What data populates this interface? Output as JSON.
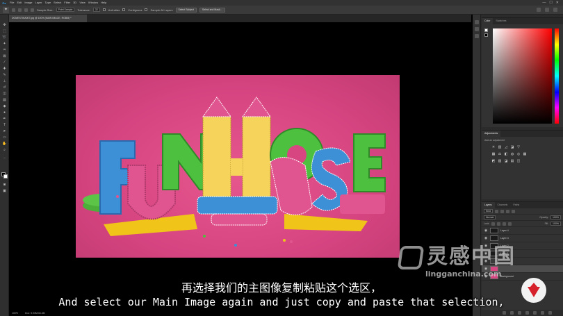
{
  "app": {
    "logo_text": "Ps",
    "menu": [
      "File",
      "Edit",
      "Image",
      "Layer",
      "Type",
      "Select",
      "Filter",
      "3D",
      "View",
      "Window",
      "Help"
    ],
    "window_controls": [
      "—",
      "☐",
      "✕"
    ]
  },
  "options_bar": {
    "sample_size_label": "Sample Size:",
    "sample_size_value": "Point Sample",
    "tolerance_label": "Tolerance:",
    "tolerance_value": "32",
    "anti_alias_label": "Anti-alias",
    "contiguous_label": "Contiguous",
    "sample_all_layers_label": "Sample All Layers",
    "select_subject_label": "Select Subject",
    "select_and_mask_label": "Select and Mask..."
  },
  "document": {
    "tab_title": "DOMESTIKA007.jpg @ 100% (MAIN IMAGE, RGB/8) *",
    "zoom": "100%",
    "doc_size": "Doc: 5.93M/34.4M"
  },
  "artwork": {
    "letters": [
      "F",
      "U",
      "N",
      "H",
      "O",
      "U",
      "S",
      "E"
    ]
  },
  "panels": {
    "color_tabs": [
      "Color",
      "Swatches"
    ],
    "adjustments_tab": "Adjustments",
    "adjustments_hint": "Add an adjustment",
    "layers_tabs": [
      "Layers",
      "Channels",
      "Paths"
    ],
    "kind_label": "Kind",
    "blend_mode": "Normal",
    "opacity_label": "Opacity:",
    "opacity_value": "100%",
    "lock_label": "Lock:",
    "fill_label": "Fill:",
    "fill_value": "100%",
    "layers": [
      {
        "name": "Layer 4"
      },
      {
        "name": "Layer 3"
      },
      {
        "name": "Layer 2"
      },
      {
        "name": "Layer 1"
      },
      {
        "name": ""
      },
      {
        "name": ""
      },
      {
        "name": "Background"
      }
    ]
  },
  "subtitles": {
    "cn": "再选择我们的主图像复制粘贴这个选区，",
    "en": "And select our Main Image again and just copy and paste that selection,"
  },
  "watermark": {
    "brand_cn": "灵感中国",
    "url": "lingganchina.com"
  },
  "colors": {
    "ui_dark": "#323232",
    "canvas_bg": "#000000",
    "artwork_pink": "#d84682",
    "accent_blue": "#31a8ff"
  }
}
